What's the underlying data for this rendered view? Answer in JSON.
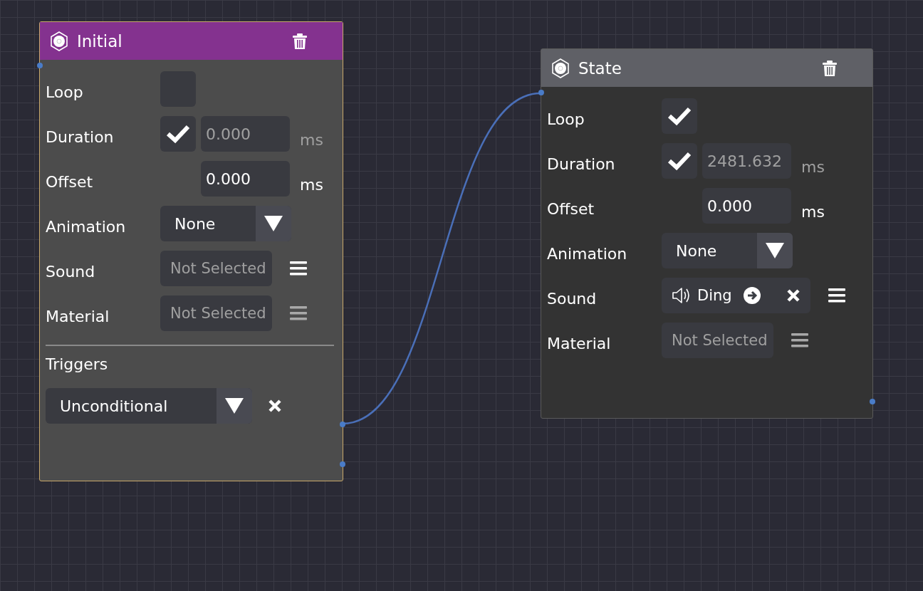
{
  "nodes": [
    {
      "kind": "initial",
      "title": "Initial",
      "selected": true,
      "fields": [
        {
          "kind": "toggle",
          "label": "Loop",
          "checked": false
        },
        {
          "kind": "toggle-number",
          "label": "Duration",
          "checked": true,
          "value": "0.000",
          "unit": "ms"
        },
        {
          "kind": "number",
          "label": "Offset",
          "value": "0.000",
          "unit": "ms"
        },
        {
          "kind": "dropdown",
          "label": "Animation",
          "value": "None"
        },
        {
          "kind": "resource",
          "label": "Sound",
          "placeholder": "Not Selected",
          "menu_enabled": true
        },
        {
          "kind": "resource",
          "label": "Material",
          "placeholder": "Not Selected",
          "menu_enabled": false
        }
      ],
      "triggers_label": "Triggers",
      "triggers": [
        {
          "value": "Unconditional"
        }
      ]
    },
    {
      "kind": "state",
      "title": "State",
      "selected": false,
      "fields": [
        {
          "kind": "toggle",
          "label": "Loop",
          "checked": true
        },
        {
          "kind": "toggle-number",
          "label": "Duration",
          "checked": true,
          "value": "2481.632",
          "unit": "ms"
        },
        {
          "kind": "number",
          "label": "Offset",
          "value": "0.000",
          "unit": "ms"
        },
        {
          "kind": "dropdown",
          "label": "Animation",
          "value": "None"
        },
        {
          "kind": "sound",
          "label": "Sound",
          "value": "Ding",
          "menu_enabled": true
        },
        {
          "kind": "resource",
          "label": "Material",
          "placeholder": "Not Selected",
          "menu_enabled": false
        }
      ]
    }
  ]
}
